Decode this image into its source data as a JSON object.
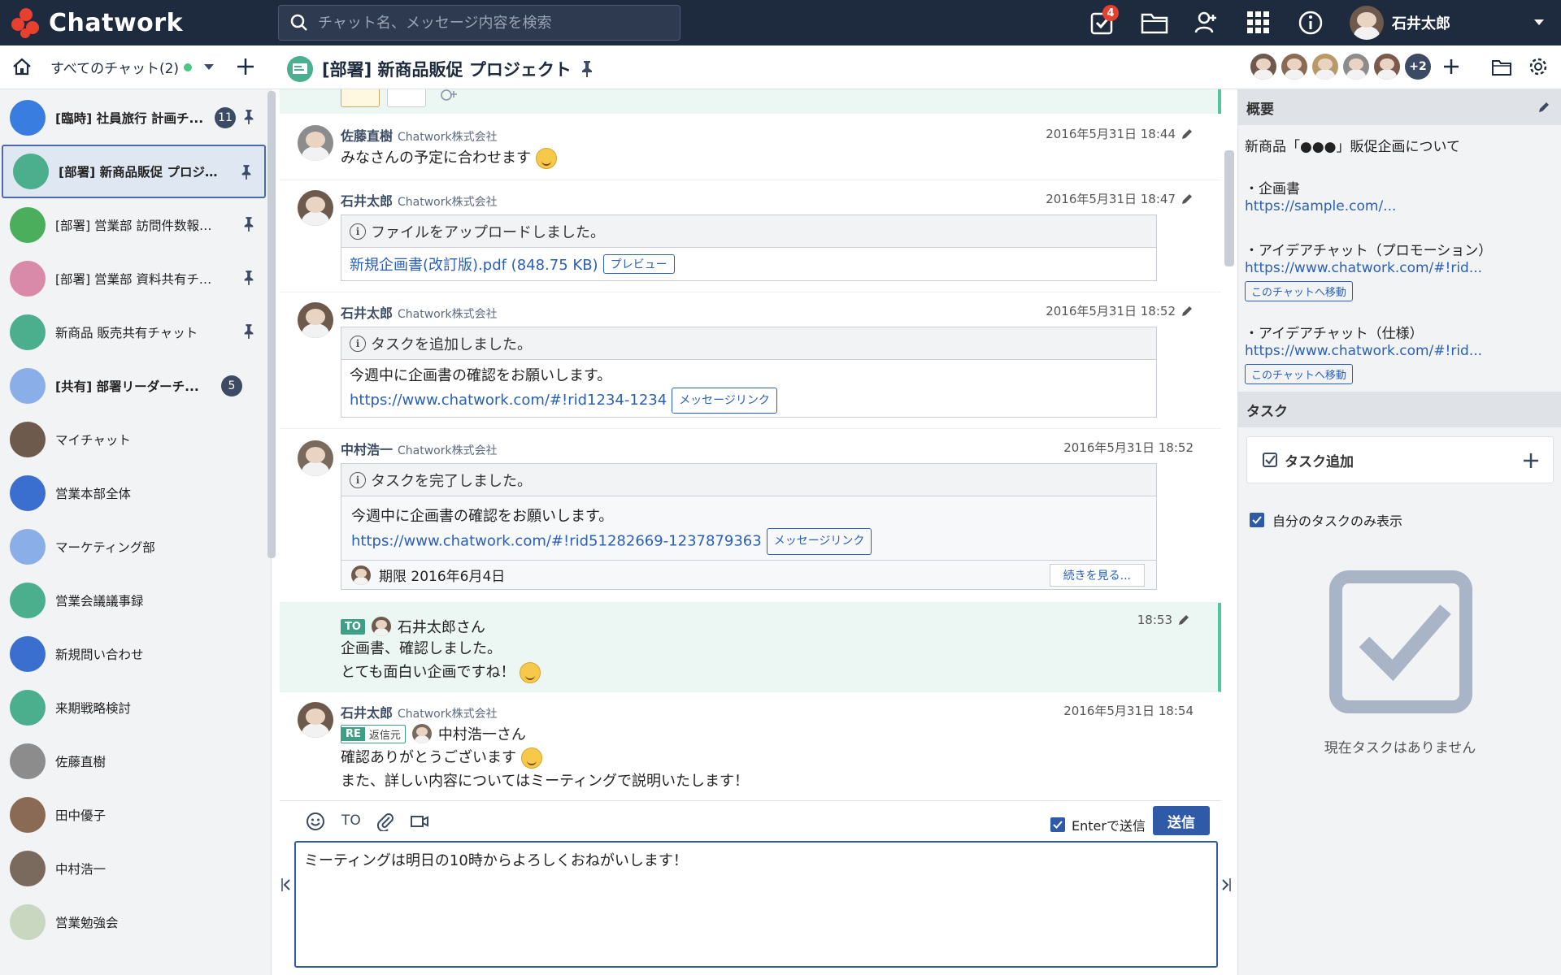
{
  "app": {
    "name": "Chatwork"
  },
  "header": {
    "search_placeholder": "チャット名、メッセージ内容を検索",
    "task_badge": "4",
    "user_name": "石井太郎"
  },
  "subbar": {
    "all_chats": "すべてのチャット(2)",
    "room_title": "[部署] 新商品販促 プロジェクト",
    "member_extra": "+2"
  },
  "sidebar": {
    "rooms": [
      {
        "name": "[臨時] 社員旅行 計画チ...",
        "bold": true,
        "unread": "11",
        "pinned": true,
        "color": "#3a7de0"
      },
      {
        "name": "[部署] 新商品販促 プロジェ...",
        "bold": true,
        "unread": "",
        "pinned": true,
        "color": "#4bae8c",
        "active": true
      },
      {
        "name": "[部署] 営業部 訪問件数報告...",
        "bold": false,
        "unread": "",
        "pinned": true,
        "color": "#4bae5c"
      },
      {
        "name": "[部署] 営業部 資料共有チャ...",
        "bold": false,
        "unread": "",
        "pinned": true,
        "color": "#d98aa8"
      },
      {
        "name": "新商品 販売共有チャット",
        "bold": false,
        "unread": "",
        "pinned": true,
        "color": "#4bae8c"
      },
      {
        "name": "[共有] 部署リーダーチ...",
        "bold": true,
        "unread": "5",
        "pinned": false,
        "color": "#8aaee8"
      },
      {
        "name": "マイチャット",
        "bold": false,
        "unread": "",
        "pinned": false,
        "color": "#6e5a4c"
      },
      {
        "name": "営業本部全体",
        "bold": false,
        "unread": "",
        "pinned": false,
        "color": "#3a6fd0"
      },
      {
        "name": "マーケティング部",
        "bold": false,
        "unread": "",
        "pinned": false,
        "color": "#8aaee8"
      },
      {
        "name": "営業会議議事録",
        "bold": false,
        "unread": "",
        "pinned": false,
        "color": "#4bae8c"
      },
      {
        "name": "新規問い合わせ",
        "bold": false,
        "unread": "",
        "pinned": false,
        "color": "#3a6fd0"
      },
      {
        "name": "来期戦略検討",
        "bold": false,
        "unread": "",
        "pinned": false,
        "color": "#4bae8c"
      },
      {
        "name": "佐藤直樹",
        "bold": false,
        "unread": "",
        "pinned": false,
        "color": "#8c8c8c"
      },
      {
        "name": "田中優子",
        "bold": false,
        "unread": "",
        "pinned": false,
        "color": "#8a6a54"
      },
      {
        "name": "中村浩一",
        "bold": false,
        "unread": "",
        "pinned": false,
        "color": "#7a6a5e"
      },
      {
        "name": "営業勉強会",
        "bold": false,
        "unread": "",
        "pinned": false,
        "color": "#c9d6c0"
      }
    ]
  },
  "messages": {
    "m1": {
      "name": "佐藤直樹",
      "org": "Chatwork株式会社",
      "time": "2016年5月31日 18:44",
      "text": "みなさんの予定に合わせます"
    },
    "m2": {
      "name": "石井太郎",
      "org": "Chatwork株式会社",
      "time": "2016年5月31日 18:47",
      "box_head": "ファイルをアップロードしました。",
      "file": "新規企画書(改訂版).pdf (848.75 KB)",
      "preview": "プレビュー"
    },
    "m3": {
      "name": "石井太郎",
      "org": "Chatwork株式会社",
      "time": "2016年5月31日 18:52",
      "box_head": "タスクを追加しました。",
      "body": "今週中に企画書の確認をお願いします。",
      "link": "https://www.chatwork.com/#!rid1234-1234",
      "link_btn": "メッセージリンク"
    },
    "m4": {
      "name": "中村浩一",
      "org": "Chatwork株式会社",
      "time": "2016年5月31日 18:52",
      "box_head": "タスクを完了しました。",
      "body": "今週中に企画書の確認をお願いします。",
      "link": "https://www.chatwork.com/#!rid51282669-1237879363",
      "link_btn": "メッセージリンク",
      "deadline": "期限 2016年6月4日",
      "more": "続きを見る..."
    },
    "m5": {
      "to_label": "TO",
      "to_name": "石井太郎さん",
      "time": "18:53",
      "line1": "企画書、確認しました。",
      "line2": "とても面白い企画ですね！"
    },
    "m6": {
      "name": "石井太郎",
      "org": "Chatwork株式会社",
      "time": "2016年5月31日 18:54",
      "re_label": "RE",
      "re_src": "返信元",
      "re_name": "中村浩一さん",
      "line1": "確認ありがとうございます",
      "line2": "また、詳しい内容についてはミーティングで説明いたします！"
    }
  },
  "composer": {
    "to_label": "TO",
    "enter_send": "Enterで送信",
    "send": "送信",
    "text": "ミーティングは明日の10時からよろしくおねがいします！"
  },
  "right": {
    "overview_title": "概要",
    "overview_line": "新商品「●●●」販促企画について",
    "item1": "・企画書",
    "link1": "https://sample.com/...",
    "item2": "・アイデアチャット（プロモーション）",
    "link2": "https://www.chatwork.com/#!rid...",
    "goto_btn": "このチャットへ移動",
    "item3": "・アイデアチャット（仕様）",
    "link3": "https://www.chatwork.com/#!rid...",
    "task_title": "タスク",
    "task_add": "タスク追加",
    "my_tasks_only": "自分のタスクのみ表示",
    "no_tasks": "現在タスクはありません"
  }
}
